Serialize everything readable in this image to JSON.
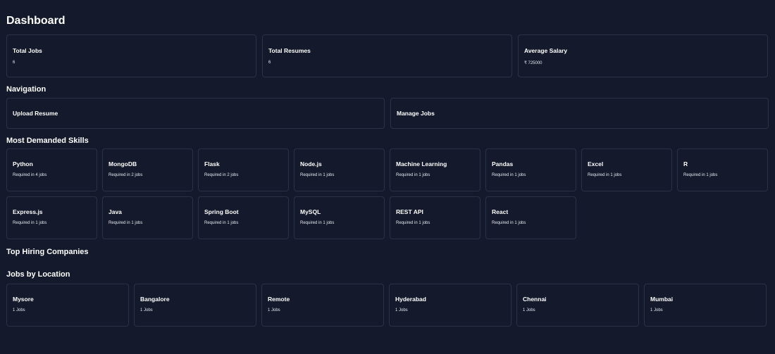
{
  "page_title": "Dashboard",
  "stats": [
    {
      "label": "Total Jobs",
      "value": "6"
    },
    {
      "label": "Total Resumes",
      "value": "6"
    },
    {
      "label": "Average Salary",
      "value": "₹ 725000"
    }
  ],
  "navigation": {
    "title": "Navigation",
    "items": [
      {
        "label": "Upload Resume"
      },
      {
        "label": "Manage Jobs"
      }
    ]
  },
  "skills": {
    "title": "Most Demanded Skills",
    "items": [
      {
        "name": "Python",
        "count": "Required in 4 jobs"
      },
      {
        "name": "MongoDB",
        "count": "Required in 2 jobs"
      },
      {
        "name": "Flask",
        "count": "Required in 2 jobs"
      },
      {
        "name": "Node.js",
        "count": "Required in 1 jobs"
      },
      {
        "name": "Machine Learning",
        "count": "Required in 1 jobs"
      },
      {
        "name": "Pandas",
        "count": "Required in 1 jobs"
      },
      {
        "name": "Excel",
        "count": "Required in 1 jobs"
      },
      {
        "name": "R",
        "count": "Required in 1 jobs"
      },
      {
        "name": "Express.js",
        "count": "Required in 1 jobs"
      },
      {
        "name": "Java",
        "count": "Required in 1 jobs"
      },
      {
        "name": "Spring Boot",
        "count": "Required in 1 jobs"
      },
      {
        "name": "MySQL",
        "count": "Required in 1 jobs"
      },
      {
        "name": "REST API",
        "count": "Required in 1 jobs"
      },
      {
        "name": "React",
        "count": "Required in 1 jobs"
      }
    ]
  },
  "companies": {
    "title": "Top Hiring Companies"
  },
  "locations": {
    "title": "Jobs by Location",
    "items": [
      {
        "city": "Mysore",
        "count": "1 Jobs"
      },
      {
        "city": "Bangalore",
        "count": "1 Jobs"
      },
      {
        "city": "Remote",
        "count": "1 Jobs"
      },
      {
        "city": "Hyderabad",
        "count": "1 Jobs"
      },
      {
        "city": "Chennai",
        "count": "1 Jobs"
      },
      {
        "city": "Mumbai",
        "count": "1 Jobs"
      }
    ]
  }
}
